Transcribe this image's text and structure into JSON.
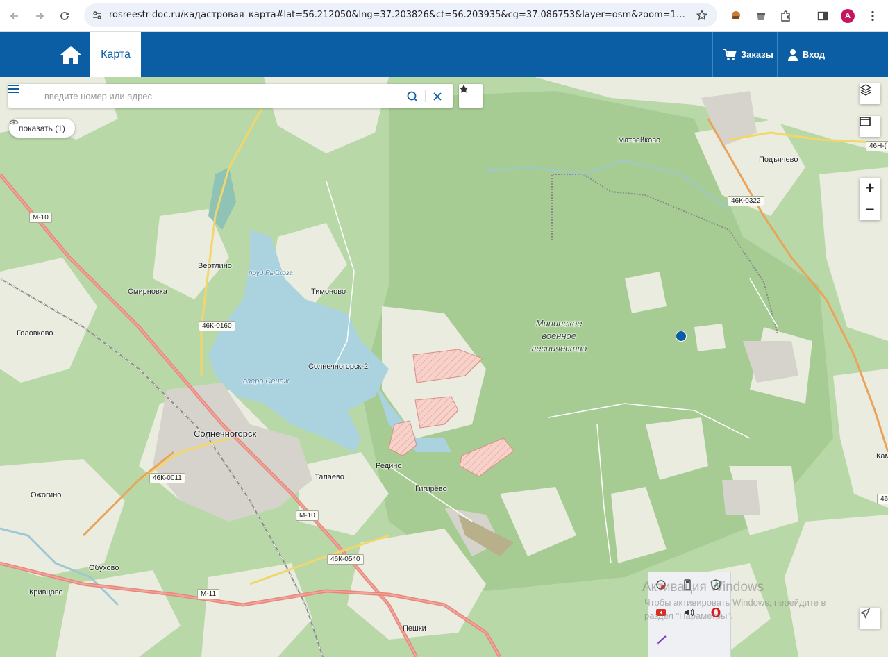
{
  "browser": {
    "url": "rosreestr-doc.ru/кадастровая_карта#lat=56.212050&lng=37.203826&ct=56.203935&cg=37.086753&layer=osm&zoom=12&zouit=f...",
    "profile_initial": "A"
  },
  "header": {
    "tab_map_label": "Карта",
    "orders_label": "Заказы",
    "login_label": "Вход"
  },
  "search": {
    "placeholder": "введите номер или адрес"
  },
  "show_button": {
    "label": "показать (1)"
  },
  "zoom": {
    "in_label": "+",
    "out_label": "−"
  },
  "map_labels": {
    "matveykovo": "Матвейково",
    "podyachevo": "Подъячево",
    "vertlino": "Вертлино",
    "prud": "пруд Рыбхоза",
    "smirnovka": "Смирновка",
    "timonovo": "Тимоново",
    "golovkovo": "Головково",
    "forest_line1": "Мининское",
    "forest_line2": "военное",
    "forest_line3": "лесничество",
    "solnech2": "Солнечногорск-2",
    "ozero": "озеро Сенеж",
    "solnechnogorsk": "Солнечногорск",
    "redino": "Редино",
    "talaevo": "Талаево",
    "gigirevo": "Гигирёво",
    "ozhogino": "Ожогино",
    "obukhovo": "Обухово",
    "krivtsovo": "Кривцово",
    "peshki": "Пешки",
    "kam": "Кам"
  },
  "road_shields": {
    "m10_a": "М-10",
    "r46k0322": "46К-0322",
    "r46n": "46Н-(",
    "r46k0160": "46К-0160",
    "r46k0011": "46К-0011",
    "m10_b": "М-10",
    "r46k0540": "46К-0540",
    "m11": "М-11",
    "r46_right": "46"
  },
  "watermark": {
    "line1": "Активация Windows",
    "line2": "Чтобы активировать Windows, перейдите в",
    "line3": "раздел \"Параметры\"."
  },
  "colors": {
    "header_blue": "#0b5da4",
    "forest_green": "#add19e",
    "water_blue": "#aad3df",
    "hatched_area": "#f4c7c0"
  }
}
